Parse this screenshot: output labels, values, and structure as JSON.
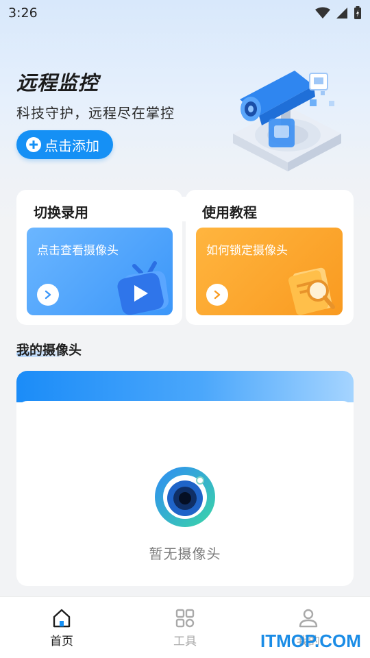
{
  "status_bar": {
    "time": "3:26"
  },
  "hero": {
    "title": "远程监控",
    "subtitle": "科技守护，远程尽在掌控",
    "add_button_label": "点击添加"
  },
  "cards": [
    {
      "title": "切换录用",
      "panel_label": "点击查看摄像头",
      "accent": "#3b96f9"
    },
    {
      "title": "使用教程",
      "panel_label": "如何锁定摄像头",
      "accent": "#f99a20"
    }
  ],
  "my_cameras": {
    "section_title": "我的摄像头",
    "empty_text": "暂无摄像头"
  },
  "bottom_nav": {
    "items": [
      {
        "label": "首页",
        "icon": "home-icon",
        "active": true
      },
      {
        "label": "工具",
        "icon": "grid-icon",
        "active": false
      },
      {
        "label": "我的",
        "icon": "profile-icon",
        "active": false
      }
    ]
  },
  "watermark": "ITMOP.COM",
  "colors": {
    "primary": "#1590f5",
    "orange": "#f99a20",
    "background": "#f2f3f5"
  }
}
